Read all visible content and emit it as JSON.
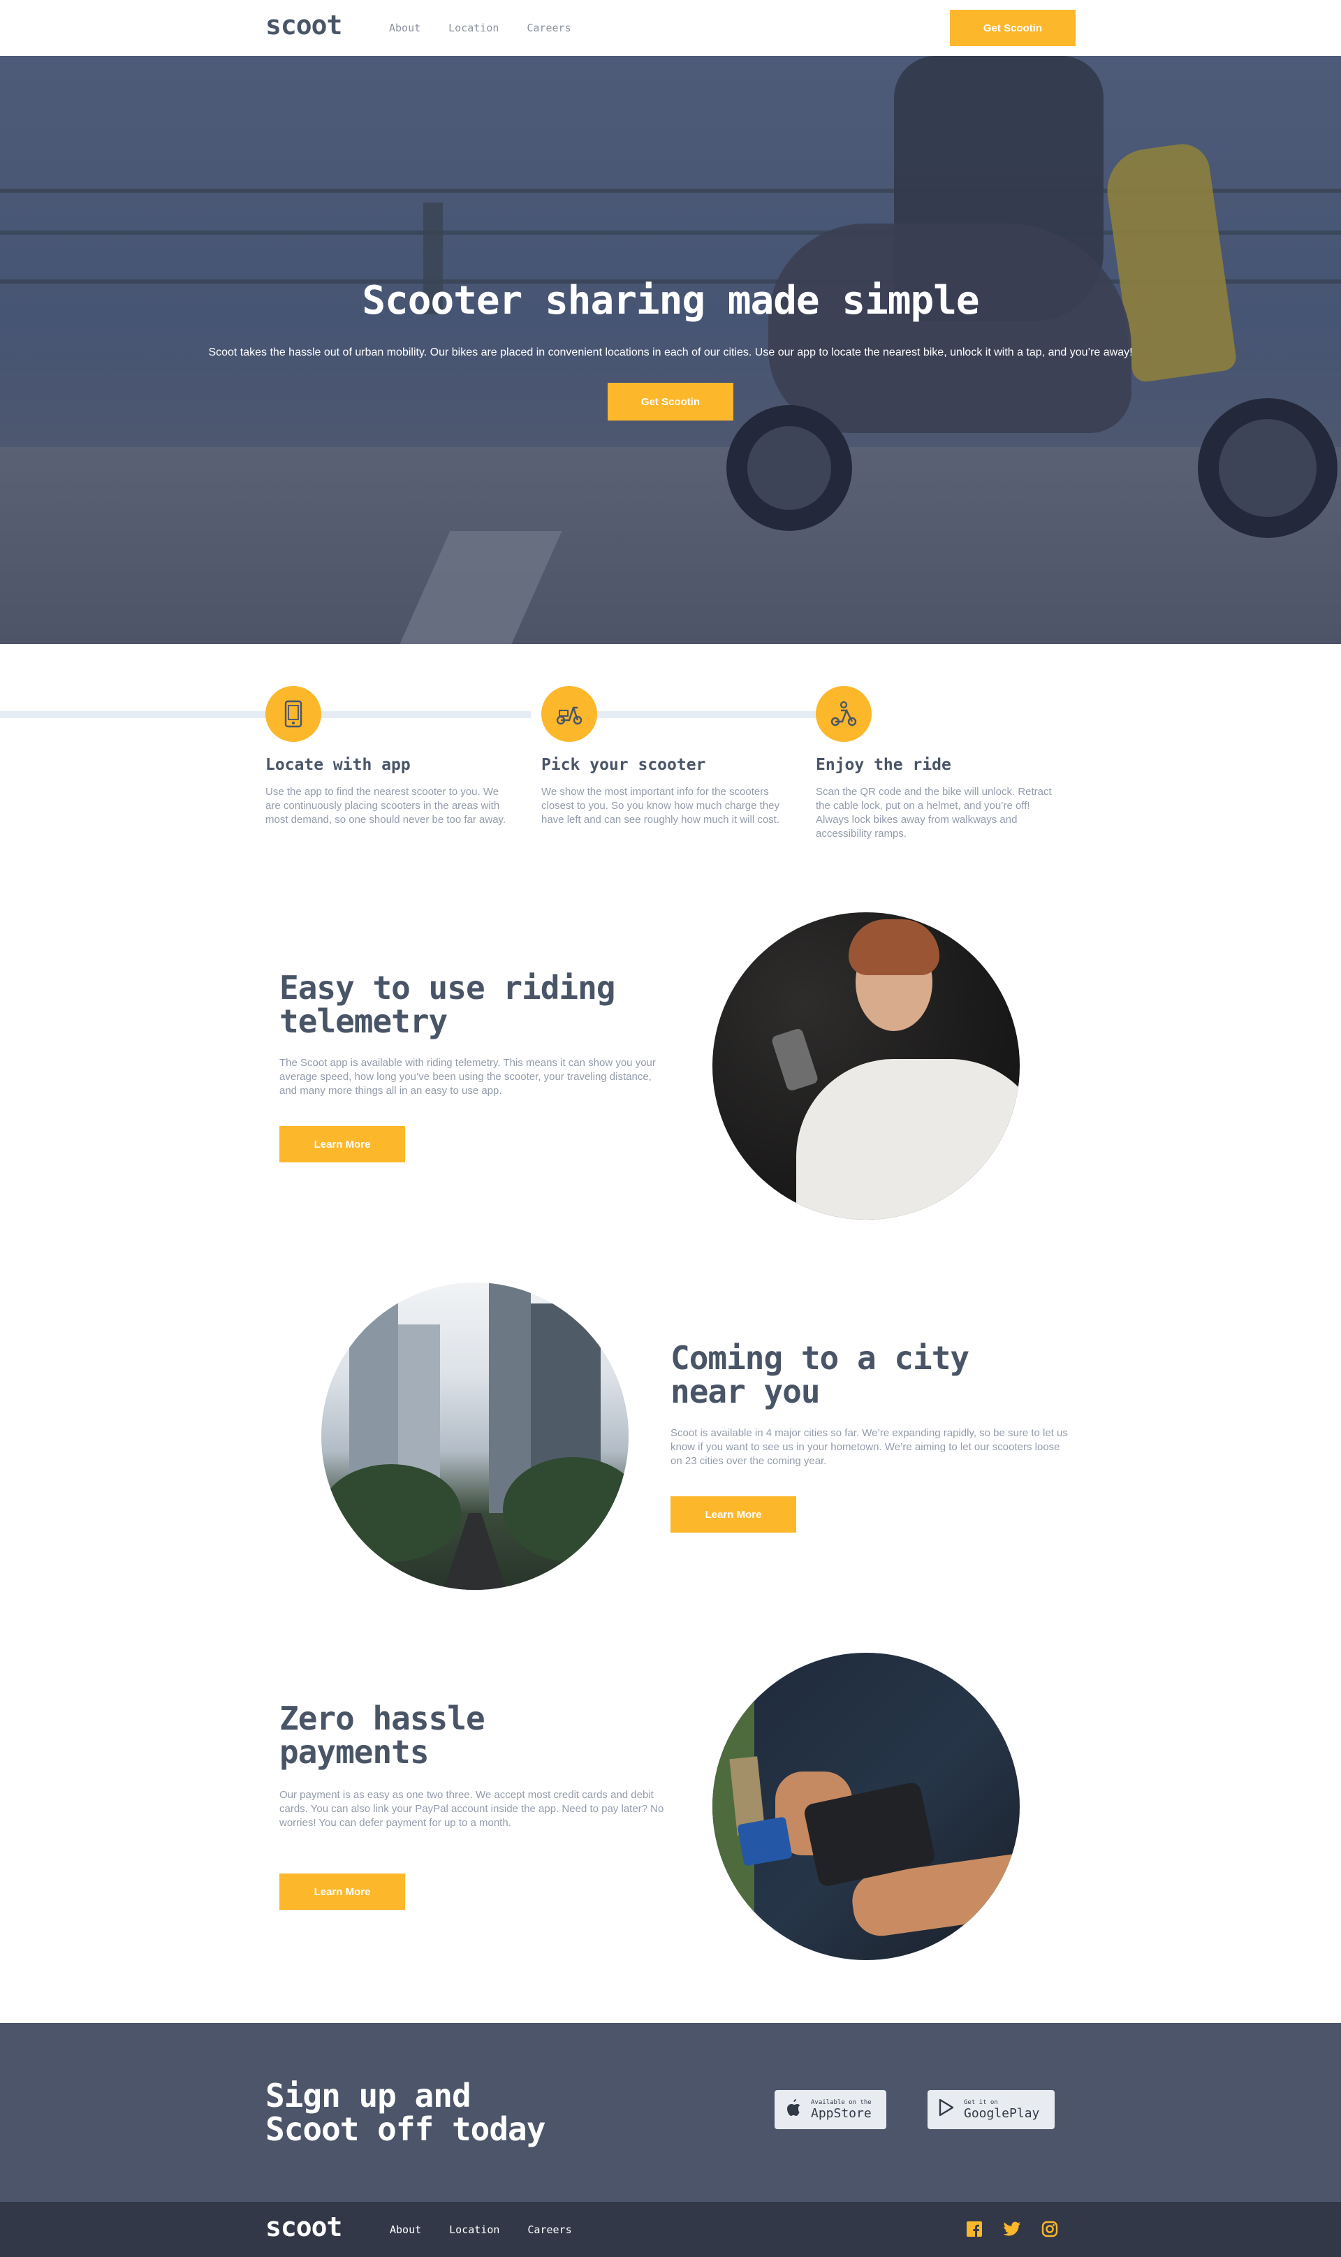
{
  "brand": {
    "logo": "scoot",
    "accent": "#fcb72b",
    "dark": "#495567"
  },
  "header": {
    "nav": [
      "About",
      "Location",
      "Careers"
    ],
    "cta": "Get Scootin"
  },
  "hero": {
    "title": "Scooter sharing made simple",
    "text": "Scoot takes the hassle out of urban mobility. Our bikes are placed in convenient locations in each of our cities. Use our app to locate the nearest bike, unlock it with a tap, and you’re away!",
    "cta": "Get Scootin"
  },
  "steps": [
    {
      "icon": "phone-app-icon",
      "title": "Locate with app",
      "text": "Use the app to find the nearest scooter to you. We are continuously placing scooters in the areas with most demand, so one should never be too far away."
    },
    {
      "icon": "scooter-icon",
      "title": "Pick your scooter",
      "text": "We show the most important info for the scooters closest to you. So you know how much charge they have left and can see roughly how much it will cost."
    },
    {
      "icon": "rider-icon",
      "title": "Enjoy the ride",
      "text": "Scan the QR code and the bike will unlock. Retract the cable lock, put on a helmet, and you’re off! Always lock bikes away from walkways and accessibility ramps."
    }
  ],
  "features": [
    {
      "title_line1": "Easy to use riding",
      "title_line2": "telemetry",
      "text": "The Scoot app is available with riding telemetry. This means it can show you your average speed, how long you’ve been using the scooter, your traveling distance, and many more things all in an easy to use app.",
      "cta": "Learn More"
    },
    {
      "title_line1": "Coming to a city",
      "title_line2": "near you",
      "text": "Scoot is available in 4 major cities so far. We’re expanding rapidly, so be sure to let us know if you want to see us in your hometown. We’re aiming to let our scooters loose on 23 cities over the coming year.",
      "cta": "Learn More"
    },
    {
      "title_line1": "Zero hassle",
      "title_line2": "payments",
      "text": "Our payment is as easy as one two three. We accept most credit cards and debit cards. You can also link your PayPal account inside the app. Need to pay later? No worries! You can defer payment for up to a month.",
      "cta": "Learn More"
    }
  ],
  "signup": {
    "title_line1": "Sign up and",
    "title_line2": "Scoot off today",
    "appstore": {
      "small": "Available on the",
      "big": "AppStore"
    },
    "googleplay": {
      "small": "Get it on",
      "big": "GooglePlay"
    }
  },
  "footer": {
    "logo": "scoot",
    "nav": [
      "About",
      "Location",
      "Careers"
    ],
    "social": [
      "facebook-icon",
      "twitter-icon",
      "instagram-icon"
    ]
  }
}
